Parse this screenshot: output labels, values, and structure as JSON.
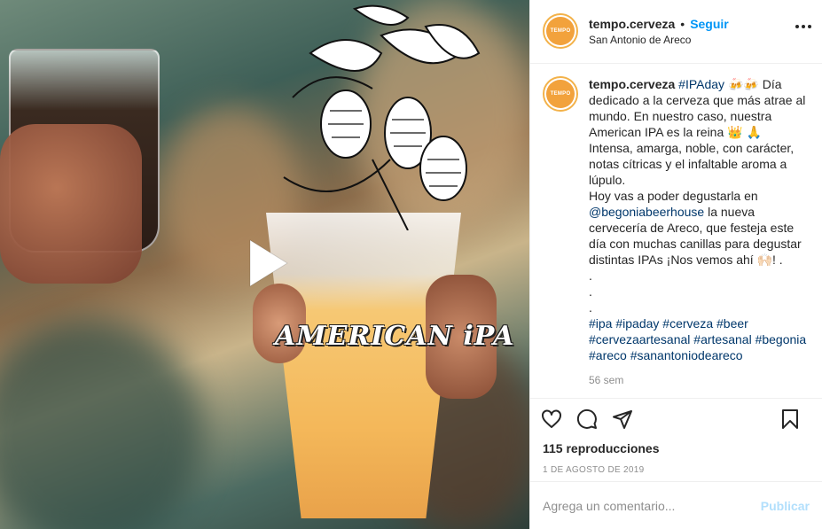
{
  "post": {
    "username": "tempo.cerveza",
    "dot": "•",
    "follow_label": "Seguir",
    "location": "San Antonio de Areco",
    "avatar_text": "TEMPO",
    "overlay_text": "AMERICAN iPA",
    "caption_lines": [
      {
        "type": "mixed",
        "parts": [
          {
            "t": "tempo.cerveza",
            "c": "u"
          },
          {
            "t": " "
          },
          {
            "t": "#IPAday",
            "c": "tag"
          },
          {
            "t": " 🍻🍻 Día dedicado a la cerveza que más atrae al mundo. En nuestro caso, nuestra American IPA es la reina 👑 🙏"
          }
        ]
      },
      {
        "type": "text",
        "t": "Intensa, amarga, noble, con carácter, notas cítricas y el infaltable aroma a lúpulo."
      },
      {
        "type": "mixed",
        "parts": [
          {
            "t": "Hoy vas a poder degustarla en "
          },
          {
            "t": "@begoniabeerhouse",
            "c": "tag"
          },
          {
            "t": " la nueva cervecería de Areco, que festeja este día con muchas canillas para degustar distintas IPAs ¡Nos vemos ahí 🙌🏻! ."
          }
        ]
      },
      {
        "type": "text",
        "t": "."
      },
      {
        "type": "text",
        "t": "."
      },
      {
        "type": "text",
        "t": "."
      },
      {
        "type": "mixed",
        "parts": [
          {
            "t": "#ipa",
            "c": "tag"
          },
          {
            "t": " "
          },
          {
            "t": "#ipaday",
            "c": "tag"
          },
          {
            "t": " "
          },
          {
            "t": "#cerveza",
            "c": "tag"
          },
          {
            "t": " "
          },
          {
            "t": "#beer",
            "c": "tag"
          },
          {
            "t": " "
          },
          {
            "t": "#cervezaartesanal",
            "c": "tag"
          },
          {
            "t": " "
          },
          {
            "t": "#artesanal",
            "c": "tag"
          },
          {
            "t": " "
          },
          {
            "t": "#begonia",
            "c": "tag"
          },
          {
            "t": " "
          },
          {
            "t": "#areco",
            "c": "tag"
          },
          {
            "t": " "
          },
          {
            "t": "#sanantoniodeareco",
            "c": "tag"
          }
        ]
      }
    ],
    "time_ago": "56 sem",
    "views": "115 reproducciones",
    "date": "1 DE AGOSTO DE 2019",
    "comment_placeholder": "Agrega un comentario...",
    "publish_label": "Publicar"
  },
  "icons": {
    "play": "play-icon",
    "like": "heart-icon",
    "comment": "comment-icon",
    "share": "share-icon",
    "save": "bookmark-icon",
    "more": "more-icon"
  },
  "colors": {
    "accent": "#0095f6",
    "tag": "#00376b",
    "avatar": "#f2a23c",
    "muted": "#8e8e8e",
    "publish_disabled": "#b2dffc"
  }
}
